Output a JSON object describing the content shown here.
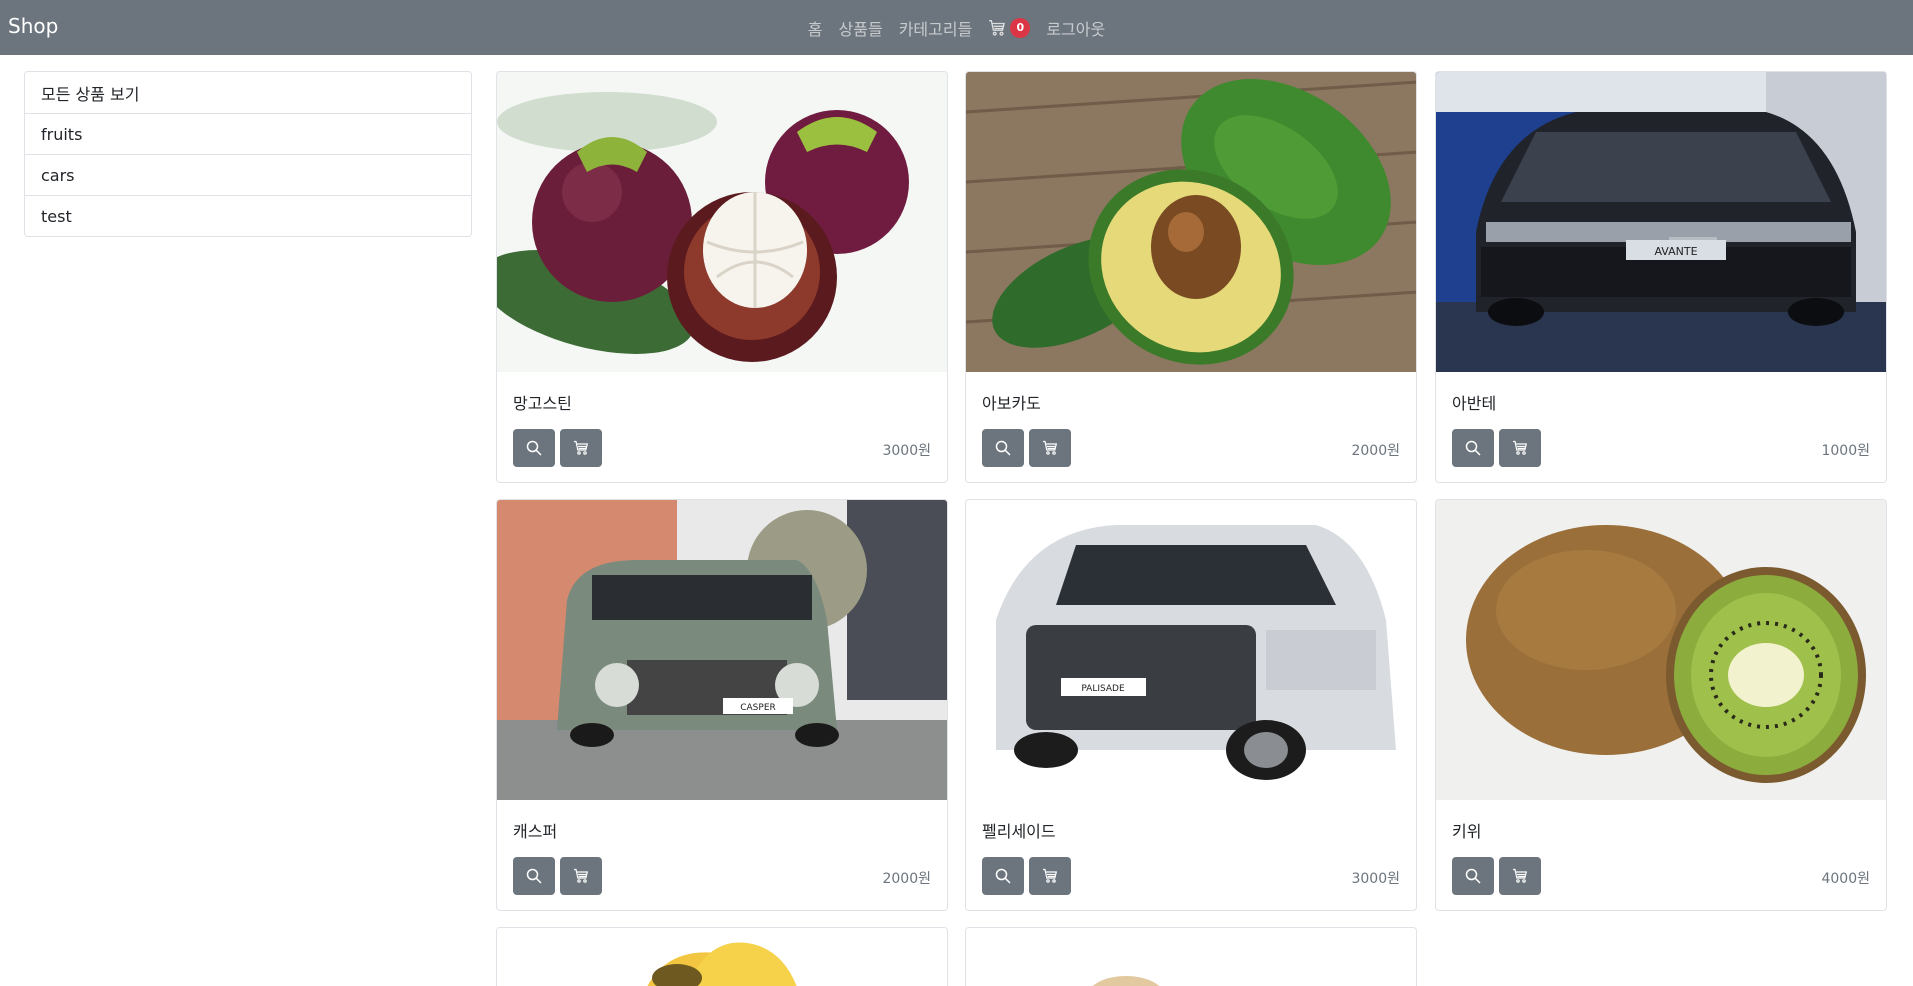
{
  "navbar": {
    "brand": "Shop",
    "links": {
      "home": "홈",
      "products": "상품들",
      "categories": "카테고리들",
      "logout": "로그아웃"
    },
    "cart_count": "0",
    "bg_color": "#6c757d",
    "badge_color": "#dc3545"
  },
  "sidebar": {
    "items": [
      {
        "label": "모든 상품 보기"
      },
      {
        "label": "fruits"
      },
      {
        "label": "cars"
      },
      {
        "label": "test"
      }
    ]
  },
  "products": [
    {
      "name": "망고스틴",
      "price": "3000원",
      "image": "mangosteen"
    },
    {
      "name": "아보카도",
      "price": "2000원",
      "image": "avocado"
    },
    {
      "name": "아반테",
      "price": "1000원",
      "image": "avante-car"
    },
    {
      "name": "캐스퍼",
      "price": "2000원",
      "image": "casper-car"
    },
    {
      "name": "펠리세이드",
      "price": "3000원",
      "image": "palisade-car"
    },
    {
      "name": "키위",
      "price": "4000원",
      "image": "kiwi"
    },
    {
      "name": "",
      "price": "",
      "image": "banana"
    },
    {
      "name": "",
      "price": "",
      "image": "potato"
    }
  ],
  "icons": {
    "view": "search-icon",
    "cart": "cart-icon"
  },
  "car_plates": {
    "avante": "AVANTE",
    "casper": "CASPER",
    "palisade": "PALISADE"
  }
}
